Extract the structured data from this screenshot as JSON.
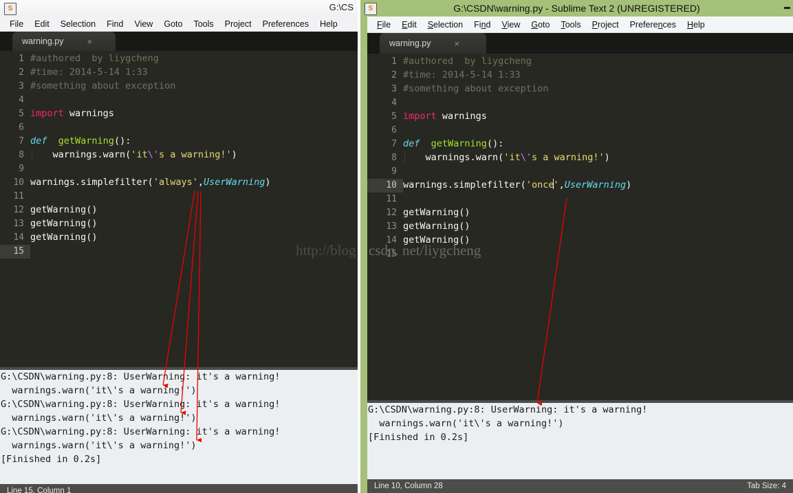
{
  "left_window": {
    "title": "G:\\CS",
    "app_icon": "sublime-text-icon",
    "menu": [
      "File",
      "Edit",
      "Selection",
      "Find",
      "View",
      "Goto",
      "Tools",
      "Project",
      "Preferences",
      "Help"
    ],
    "tab": {
      "label": "warning.py",
      "close": "×"
    },
    "code_lines": [
      {
        "num": "1",
        "active": false,
        "tokens": [
          {
            "t": "#authored  by liygcheng",
            "c": "c-comment"
          }
        ]
      },
      {
        "num": "2",
        "active": false,
        "tokens": [
          {
            "t": "#time: 2014-5-14 1:33",
            "c": "c-comment"
          }
        ]
      },
      {
        "num": "3",
        "active": false,
        "tokens": [
          {
            "t": "#something about exception",
            "c": "c-comment"
          }
        ]
      },
      {
        "num": "4",
        "active": false,
        "tokens": []
      },
      {
        "num": "5",
        "active": false,
        "tokens": [
          {
            "t": "import",
            "c": "c-kw"
          },
          {
            "t": " warnings",
            "c": "c-plain"
          }
        ]
      },
      {
        "num": "6",
        "active": false,
        "tokens": []
      },
      {
        "num": "7",
        "active": false,
        "tokens": [
          {
            "t": "def",
            "c": "c-def"
          },
          {
            "t": "  ",
            "c": "c-plain"
          },
          {
            "t": "getWarning",
            "c": "c-fn"
          },
          {
            "t": "():",
            "c": "c-plain"
          }
        ]
      },
      {
        "num": "8",
        "active": false,
        "tokens": [
          {
            "t": "    warnings.warn(",
            "c": "c-plain"
          },
          {
            "t": "'it",
            "c": "c-str"
          },
          {
            "t": "\\'",
            "c": "c-esc"
          },
          {
            "t": "s a warning!'",
            "c": "c-str"
          },
          {
            "t": ")",
            "c": "c-plain"
          }
        ]
      },
      {
        "num": "9",
        "active": false,
        "tokens": []
      },
      {
        "num": "10",
        "active": false,
        "tokens": [
          {
            "t": "warnings.simplefilter(",
            "c": "c-plain"
          },
          {
            "t": "'always'",
            "c": "c-str"
          },
          {
            "t": ",",
            "c": "c-plain"
          },
          {
            "t": "UserWarning",
            "c": "c-cls"
          },
          {
            "t": ")",
            "c": "c-plain"
          }
        ]
      },
      {
        "num": "11",
        "active": false,
        "tokens": []
      },
      {
        "num": "12",
        "active": false,
        "tokens": [
          {
            "t": "getWarning()",
            "c": "c-plain"
          }
        ]
      },
      {
        "num": "13",
        "active": false,
        "tokens": [
          {
            "t": "getWarning()",
            "c": "c-plain"
          }
        ]
      },
      {
        "num": "14",
        "active": false,
        "tokens": [
          {
            "t": "getWarning()",
            "c": "c-plain"
          }
        ]
      },
      {
        "num": "15",
        "active": true,
        "tokens": []
      }
    ],
    "console_lines": [
      "G:\\CSDN\\warning.py:8: UserWarning: it's a warning!",
      "  warnings.warn('it\\'s a warning!')",
      "G:\\CSDN\\warning.py:8: UserWarning: it's a warning!",
      "  warnings.warn('it\\'s a warning!')",
      "G:\\CSDN\\warning.py:8: UserWarning: it's a warning!",
      "  warnings.warn('it\\'s a warning!')",
      "[Finished in 0.2s]"
    ],
    "status": {
      "left": "Line 15, Column 1",
      "right": ""
    }
  },
  "right_window": {
    "title": "G:\\CSDN\\warning.py - Sublime Text 2 (UNREGISTERED)",
    "app_icon": "sublime-text-icon",
    "minimize_label": "minimize-button",
    "menu": [
      {
        "pre": "",
        "accel": "F",
        "post": "ile"
      },
      {
        "pre": "",
        "accel": "E",
        "post": "dit"
      },
      {
        "pre": "",
        "accel": "S",
        "post": "election"
      },
      {
        "pre": "Fi",
        "accel": "n",
        "post": "d"
      },
      {
        "pre": "",
        "accel": "V",
        "post": "iew"
      },
      {
        "pre": "",
        "accel": "G",
        "post": "oto"
      },
      {
        "pre": "",
        "accel": "T",
        "post": "ools"
      },
      {
        "pre": "",
        "accel": "P",
        "post": "roject"
      },
      {
        "pre": "Prefere",
        "accel": "n",
        "post": "ces"
      },
      {
        "pre": "",
        "accel": "H",
        "post": "elp"
      }
    ],
    "tab": {
      "label": "warning.py",
      "close": "×"
    },
    "code_lines": [
      {
        "num": "1",
        "active": false,
        "tokens": [
          {
            "t": "#authored  by liygcheng",
            "c": "c-comment"
          }
        ]
      },
      {
        "num": "2",
        "active": false,
        "tokens": [
          {
            "t": "#time: 2014-5-14 1:33",
            "c": "c-comment"
          }
        ]
      },
      {
        "num": "3",
        "active": false,
        "tokens": [
          {
            "t": "#something about exception",
            "c": "c-comment"
          }
        ]
      },
      {
        "num": "4",
        "active": false,
        "tokens": []
      },
      {
        "num": "5",
        "active": false,
        "tokens": [
          {
            "t": "import",
            "c": "c-kw"
          },
          {
            "t": " warnings",
            "c": "c-plain"
          }
        ]
      },
      {
        "num": "6",
        "active": false,
        "tokens": []
      },
      {
        "num": "7",
        "active": false,
        "tokens": [
          {
            "t": "def",
            "c": "c-def"
          },
          {
            "t": "  ",
            "c": "c-plain"
          },
          {
            "t": "getWarning",
            "c": "c-fn"
          },
          {
            "t": "():",
            "c": "c-plain"
          }
        ]
      },
      {
        "num": "8",
        "active": false,
        "tokens": [
          {
            "t": "    warnings.warn(",
            "c": "c-plain"
          },
          {
            "t": "'it",
            "c": "c-str"
          },
          {
            "t": "\\'",
            "c": "c-esc"
          },
          {
            "t": "s a warning!'",
            "c": "c-str"
          },
          {
            "t": ")",
            "c": "c-plain"
          }
        ]
      },
      {
        "num": "9",
        "active": false,
        "tokens": []
      },
      {
        "num": "10",
        "active": true,
        "tokens": [
          {
            "t": "warnings.simplefilter(",
            "c": "c-plain"
          },
          {
            "t": "'once",
            "c": "c-str"
          },
          {
            "t": "|caret|",
            "c": "caret"
          },
          {
            "t": "'",
            "c": "c-str"
          },
          {
            "t": ",",
            "c": "c-plain"
          },
          {
            "t": "UserWarning",
            "c": "c-cls"
          },
          {
            "t": ")",
            "c": "c-plain"
          }
        ]
      },
      {
        "num": "11",
        "active": false,
        "tokens": []
      },
      {
        "num": "12",
        "active": false,
        "tokens": [
          {
            "t": "getWarning()",
            "c": "c-plain"
          }
        ]
      },
      {
        "num": "13",
        "active": false,
        "tokens": [
          {
            "t": "getWarning()",
            "c": "c-plain"
          }
        ]
      },
      {
        "num": "14",
        "active": false,
        "tokens": [
          {
            "t": "getWarning()",
            "c": "c-plain"
          }
        ]
      },
      {
        "num": "15",
        "active": false,
        "tokens": []
      }
    ],
    "console_lines": [
      "G:\\CSDN\\warning.py:8: UserWarning: it's a warning!",
      "  warnings.warn('it\\'s a warning!')",
      "[Finished in 0.2s]"
    ],
    "status": {
      "left": "Line 10, Column 28",
      "right": "Tab Size: 4"
    }
  },
  "watermark": {
    "left_part": "http://blog",
    "right_part": "csdn. net/liygcheng",
    "full": "http://blog.csdn.net/liygcheng"
  },
  "annotations": {
    "color": "#ee0000",
    "note": "red arrows linking the 'always' / 'once' argument to each console warning line"
  }
}
